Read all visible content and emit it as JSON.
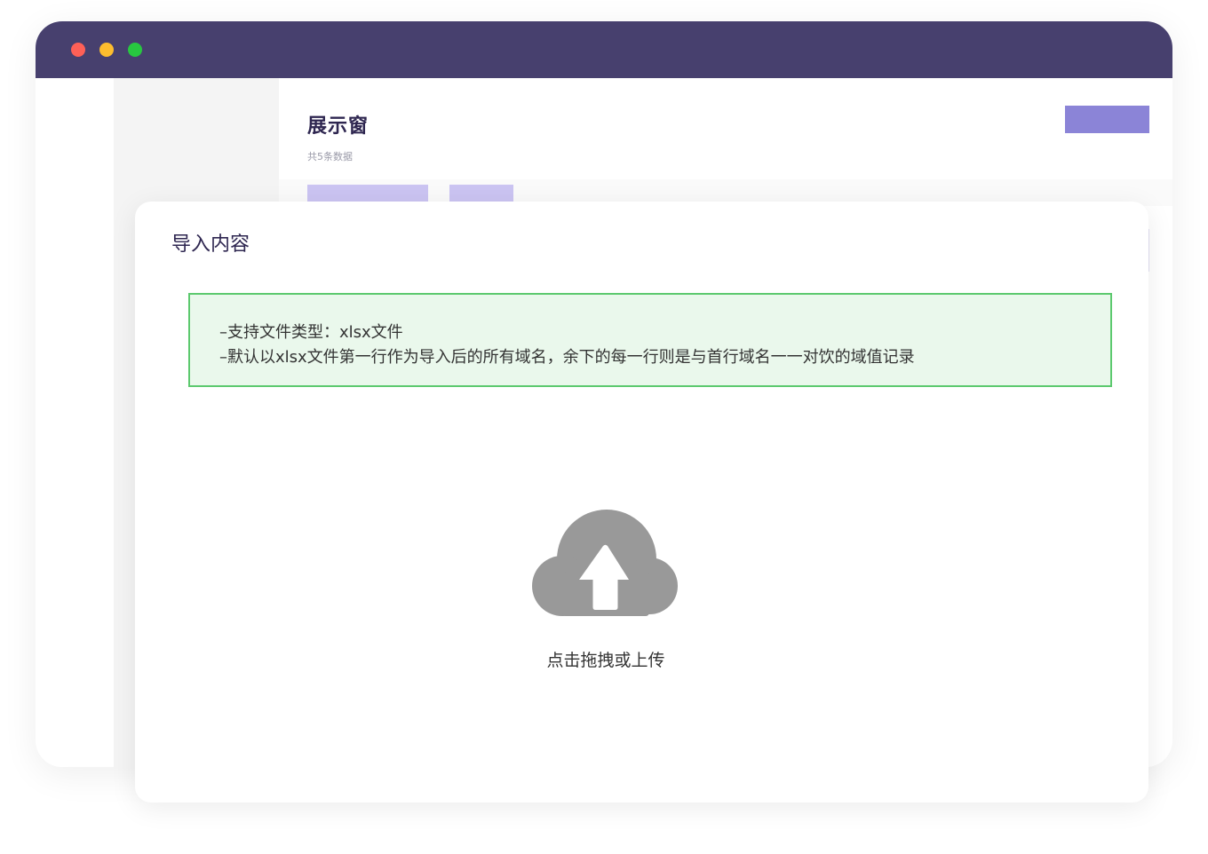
{
  "page": {
    "title": "展示窗",
    "subtitle": "共5条数据"
  },
  "colors": {
    "titlebar": "#47406e",
    "accent": "#8b84d7",
    "accent_light": "#cbc4f2",
    "notice_border": "#5cc96e",
    "notice_bg": "#eaf8ec",
    "icon_gray": "#999999"
  },
  "modal": {
    "title": "导入内容",
    "notice_lines": [
      "–支持文件类型：xlsx文件",
      "–默认以xlsx文件第一行作为导入后的所有域名，余下的每一行则是与首行域名一一对饮的域值记录"
    ],
    "upload": {
      "icon": "cloud-upload-icon",
      "label": "点击拖拽或上传"
    }
  }
}
